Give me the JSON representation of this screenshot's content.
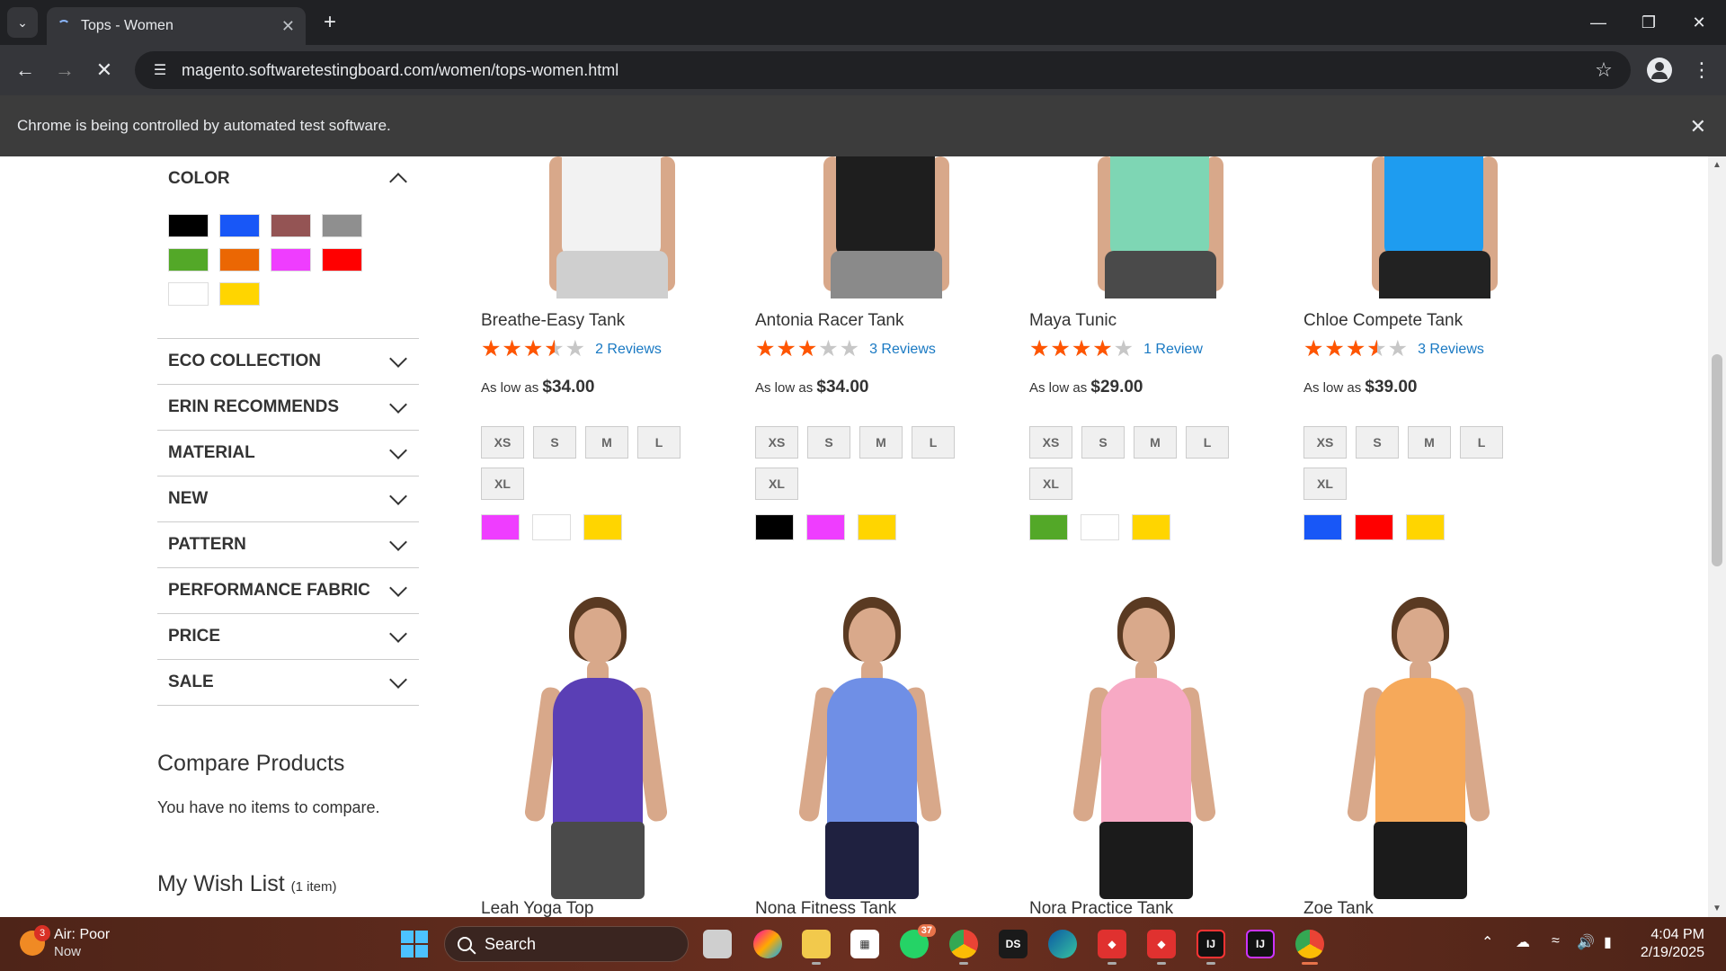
{
  "browser": {
    "tab_title": "Tops - Women",
    "url": "magento.softwaretestingboard.com/women/tops-women.html",
    "infobar_text": "Chrome is being controlled by automated test software."
  },
  "sidebar": {
    "color_filter": {
      "title": "COLOR",
      "swatches": [
        "#000000",
        "#1857f7",
        "#945454",
        "#8f8f8f",
        "#53a828",
        "#eb6703",
        "#ef3dff",
        "#ff0000",
        "#ffffff",
        "#ffd500"
      ]
    },
    "filters": [
      {
        "label": "ECO COLLECTION"
      },
      {
        "label": "ERIN RECOMMENDS"
      },
      {
        "label": "MATERIAL"
      },
      {
        "label": "NEW"
      },
      {
        "label": "PATTERN"
      },
      {
        "label": "PERFORMANCE FABRIC"
      },
      {
        "label": "PRICE"
      },
      {
        "label": "SALE"
      }
    ],
    "compare": {
      "title": "Compare Products",
      "empty_text": "You have no items to compare."
    },
    "wishlist": {
      "title": "My Wish List",
      "count": "(1 item)"
    }
  },
  "products": [
    {
      "name": "Breathe-Easy Tank",
      "rating": 0.7,
      "reviews": "2 Reviews",
      "price_prefix": "As low as",
      "price": "$34.00",
      "sizes": [
        "XS",
        "S",
        "M",
        "L",
        "XL"
      ],
      "colors": [
        "#ef3dff",
        "#ffffff",
        "#ffd500"
      ],
      "top_color": "#f2f2f2",
      "bottom_color": "#cfcfcf"
    },
    {
      "name": "Antonia Racer Tank",
      "rating": 0.6,
      "reviews": "3 Reviews",
      "price_prefix": "As low as",
      "price": "$34.00",
      "sizes": [
        "XS",
        "S",
        "M",
        "L",
        "XL"
      ],
      "colors": [
        "#000000",
        "#ef3dff",
        "#ffd500"
      ],
      "top_color": "#1e1e1e",
      "bottom_color": "#8a8a8a"
    },
    {
      "name": "Maya Tunic",
      "rating": 0.8,
      "reviews": "1 Review",
      "price_prefix": "As low as",
      "price": "$29.00",
      "sizes": [
        "XS",
        "S",
        "M",
        "L",
        "XL"
      ],
      "colors": [
        "#53a828",
        "#ffffff",
        "#ffd500"
      ],
      "top_color": "#7ed6b4",
      "bottom_color": "#4a4a4a"
    },
    {
      "name": "Chloe Compete Tank",
      "rating": 0.7,
      "reviews": "3 Reviews",
      "price_prefix": "As low as",
      "price": "$39.00",
      "sizes": [
        "XS",
        "S",
        "M",
        "L",
        "XL"
      ],
      "colors": [
        "#1857f7",
        "#ff0000",
        "#ffd500"
      ],
      "top_color": "#1e9cf0",
      "bottom_color": "#222222"
    }
  ],
  "products_row2": [
    {
      "name": "Leah Yoga Top",
      "top_color": "#5a3fb5",
      "bottom_color": "#4a4a4a"
    },
    {
      "name": "Nona Fitness Tank",
      "top_color": "#6f8fe6",
      "bottom_color": "#1f2140"
    },
    {
      "name": "Nora Practice Tank",
      "top_color": "#f7a9c4",
      "bottom_color": "#1b1b1b"
    },
    {
      "name": "Zoe Tank",
      "top_color": "#f6a95a",
      "bottom_color": "#1b1b1b"
    }
  ],
  "taskbar": {
    "weather_title": "Air: Poor",
    "weather_sub": "Now",
    "weather_badge": "3",
    "search_label": "Search",
    "whatsapp_badge": "37",
    "time": "4:04 PM",
    "date": "2/19/2025"
  }
}
